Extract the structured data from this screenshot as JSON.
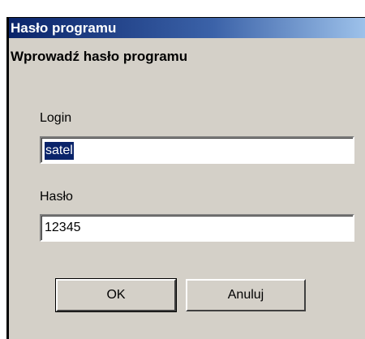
{
  "window": {
    "title": "Hasło programu"
  },
  "prompt": "Wprowadź hasło programu",
  "login": {
    "label": "Login",
    "value": "satel"
  },
  "password": {
    "label": "Hasło",
    "value": "12345"
  },
  "buttons": {
    "ok": "OK",
    "cancel": "Anuluj"
  },
  "colors": {
    "titlebar_start": "#0a246a",
    "titlebar_end": "#a6caf0",
    "dialog_bg": "#d4d0c8",
    "selection": "#0a246a"
  }
}
